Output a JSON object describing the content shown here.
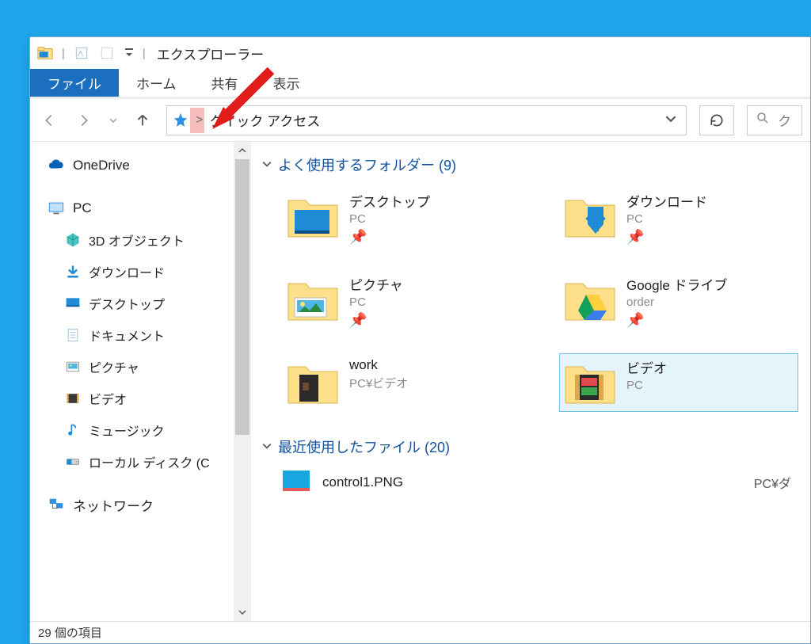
{
  "title": "エクスプローラー",
  "ribbon": {
    "tabs": [
      {
        "label": "ファイル",
        "active": true
      },
      {
        "label": "ホーム",
        "active": false
      },
      {
        "label": "共有",
        "active": false
      },
      {
        "label": "表示",
        "active": false
      }
    ]
  },
  "address": {
    "location": "クイック アクセス",
    "crumb_separator": ">"
  },
  "search": {
    "placeholder": "ク"
  },
  "sidebar": {
    "onedrive": "OneDrive",
    "pc": "PC",
    "pc_children": [
      "3D オブジェクト",
      "ダウンロード",
      "デスクトップ",
      "ドキュメント",
      "ピクチャ",
      "ビデオ",
      "ミュージック",
      "ローカル ディスク (C"
    ],
    "network": "ネットワーク"
  },
  "groups": {
    "frequent": {
      "title": "よく使用するフォルダー",
      "count": 9
    },
    "recent": {
      "title": "最近使用したファイル",
      "count": 20
    }
  },
  "folders": [
    {
      "name": "デスクトップ",
      "sub": "PC",
      "pinned": true,
      "icon": "desktop"
    },
    {
      "name": "ダウンロード",
      "sub": "PC",
      "pinned": true,
      "icon": "downloads"
    },
    {
      "name": "ピクチャ",
      "sub": "PC",
      "pinned": true,
      "icon": "pictures"
    },
    {
      "name": "Google ドライブ",
      "sub": "order",
      "pinned": true,
      "icon": "gdrive"
    },
    {
      "name": "work",
      "sub": "PC¥ビデオ",
      "pinned": false,
      "icon": "folder-dark"
    },
    {
      "name": "ビデオ",
      "sub": "PC",
      "pinned": false,
      "icon": "videos",
      "selected": true
    }
  ],
  "recent_files": [
    {
      "name": "control1.PNG",
      "path": "PC¥ダ",
      "icon": "image"
    }
  ],
  "status": {
    "item_count_text": "29 個の項目"
  }
}
